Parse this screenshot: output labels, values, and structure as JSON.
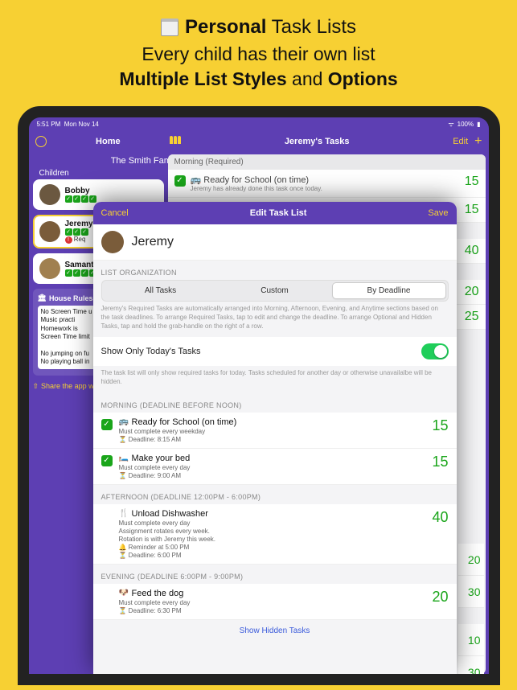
{
  "hero": {
    "title_strong": "Personal",
    "title_rest": "Task Lists",
    "subtitle1": "Every child has their own list",
    "subtitle2_a": "Multiple List Styles",
    "subtitle2_mid": "and",
    "subtitle2_b": "Options"
  },
  "status": {
    "time": "5:51 PM",
    "date": "Mon Nov 14",
    "battery": "100%"
  },
  "nav": {
    "home": "Home",
    "page_title": "Jeremy's Tasks",
    "edit": "Edit",
    "family": "The Smith Family",
    "children_label": "Children"
  },
  "children": [
    {
      "name": "Bobby",
      "selected": false,
      "req": false
    },
    {
      "name": "Jeremy",
      "selected": true,
      "req": true,
      "req_label": "Req"
    },
    {
      "name": "Samantha",
      "selected": false,
      "req": false
    }
  ],
  "house": {
    "title": "House Rules",
    "rules_text": "No Screen Time u\n  Music practi\n  Homework is\nScreen Time limit\n\nNo jumping on fu\nNo playing ball in"
  },
  "share": "Share the app w",
  "bg_tasks": {
    "section": "Morning (Required)",
    "row1": "Ready for School (on time)",
    "row1_note": "Jeremy has already done this task once today.",
    "pts1": "15",
    "pts2": "15",
    "pts3": "40",
    "pts4": "20",
    "pts5": "25"
  },
  "peek": [
    "20",
    "30",
    "10",
    "30"
  ],
  "modal": {
    "cancel": "Cancel",
    "title": "Edit Task List",
    "save": "Save",
    "child": "Jeremy",
    "org_label": "LIST ORGANIZATION",
    "seg": [
      "All Tasks",
      "Custom",
      "By Deadline"
    ],
    "seg_active": 2,
    "help1": "Jeremy's Required Tasks are automatically arranged into Morning, Afternoon, Evening, and Anytime sections based on the task deadlines. To arrange Required Tasks, tap to edit and change the deadline. To arrange Optional and Hidden Tasks, tap and hold the grab-handle on the right of a row.",
    "toggle_label": "Show Only Today's Tasks",
    "help2": "The task list will only show required tasks for today. Tasks scheduled for another day or otherwise unavailalbe will be hidden.",
    "morning_label": "MORNING (DEADLINE BEFORE NOON)",
    "tasks_morning": [
      {
        "icon": "🚌",
        "title": "Ready for School (on time)",
        "sub": "Must complete every weekday",
        "meta": "⏳ Deadline: 8:15 AM",
        "pts": "15",
        "done": true
      },
      {
        "icon": "🛏️",
        "title": "Make your bed",
        "sub": "Must complete every day",
        "meta": "⏳ Deadline: 9:00 AM",
        "pts": "15",
        "done": true
      }
    ],
    "afternoon_label": "AFTERNOON (DEADLINE 12:00PM - 6:00PM)",
    "tasks_afternoon": [
      {
        "icon": "🍴",
        "title": "Unload Dishwasher",
        "sub": "Must complete every day",
        "sub2": "Assignment rotates every week.",
        "sub3": "Rotation is with Jeremy this week.",
        "meta1": "🔔 Reminder at 5:00 PM",
        "meta2": "⏳ Deadline: 6:00 PM",
        "pts": "40"
      }
    ],
    "evening_label": "EVENING (DEADLINE 6:00PM - 9:00PM)",
    "tasks_evening": [
      {
        "icon": "🐶",
        "title": "Feed the dog",
        "sub": "Must complete every day",
        "meta": "⏳ Deadline: 6:30 PM",
        "pts": "20"
      }
    ],
    "show_hidden": "Show Hidden Tasks"
  }
}
